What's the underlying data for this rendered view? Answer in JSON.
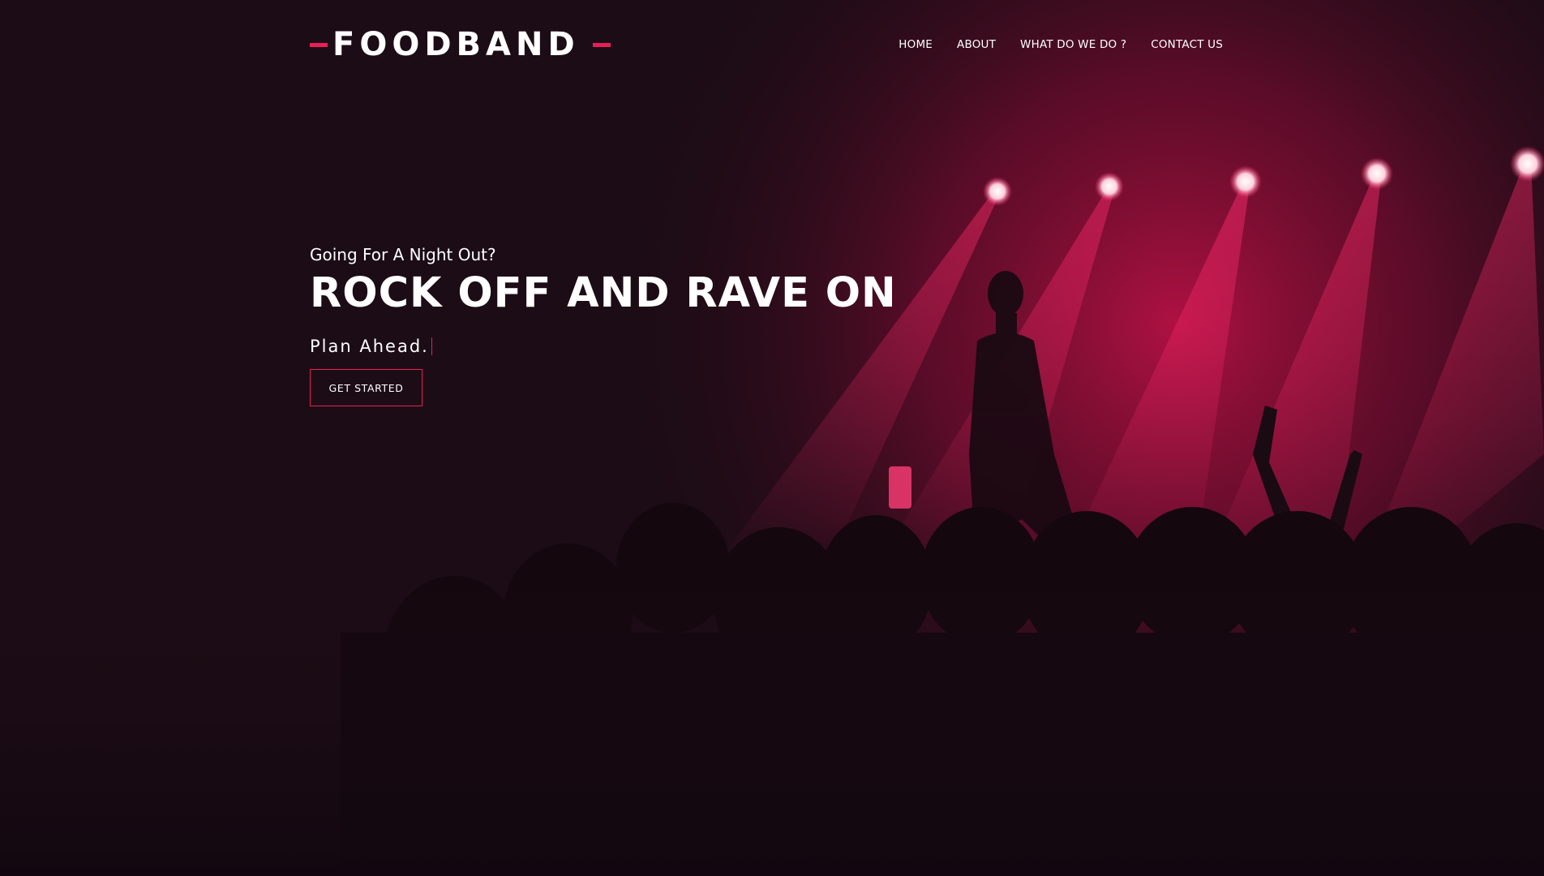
{
  "header": {
    "logo": "FOODBAND",
    "nav": [
      {
        "label": "HOME"
      },
      {
        "label": "ABOUT"
      },
      {
        "label": "WHAT DO WE DO ?"
      },
      {
        "label": "CONTACT US"
      }
    ]
  },
  "hero": {
    "pretitle": "Going For A Night Out?",
    "title": "ROCK OFF AND RAVE ON",
    "typed": "Plan Ahead.",
    "cta": "GET STARTED"
  },
  "colors": {
    "accent": "#e91e57",
    "background": "#1c0c15",
    "text": "#ffffff"
  },
  "icons": [
    "logo-dash-left",
    "logo-dash-right",
    "text-cursor"
  ]
}
